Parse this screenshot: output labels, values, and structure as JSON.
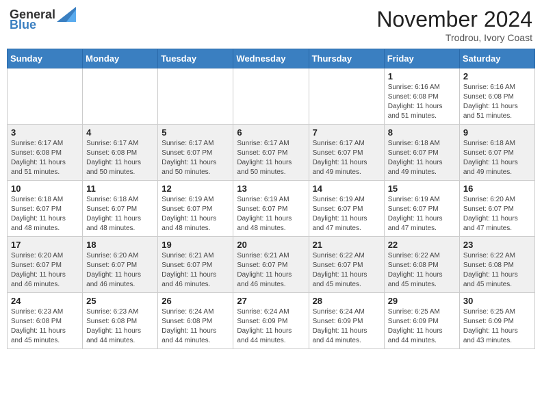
{
  "logo": {
    "text_general": "General",
    "text_blue": "Blue"
  },
  "title": "November 2024",
  "location": "Trodrou, Ivory Coast",
  "days_of_week": [
    "Sunday",
    "Monday",
    "Tuesday",
    "Wednesday",
    "Thursday",
    "Friday",
    "Saturday"
  ],
  "weeks": [
    [
      {
        "day": "",
        "info": ""
      },
      {
        "day": "",
        "info": ""
      },
      {
        "day": "",
        "info": ""
      },
      {
        "day": "",
        "info": ""
      },
      {
        "day": "",
        "info": ""
      },
      {
        "day": "1",
        "info": "Sunrise: 6:16 AM\nSunset: 6:08 PM\nDaylight: 11 hours and 51 minutes."
      },
      {
        "day": "2",
        "info": "Sunrise: 6:16 AM\nSunset: 6:08 PM\nDaylight: 11 hours and 51 minutes."
      }
    ],
    [
      {
        "day": "3",
        "info": "Sunrise: 6:17 AM\nSunset: 6:08 PM\nDaylight: 11 hours and 51 minutes."
      },
      {
        "day": "4",
        "info": "Sunrise: 6:17 AM\nSunset: 6:08 PM\nDaylight: 11 hours and 50 minutes."
      },
      {
        "day": "5",
        "info": "Sunrise: 6:17 AM\nSunset: 6:07 PM\nDaylight: 11 hours and 50 minutes."
      },
      {
        "day": "6",
        "info": "Sunrise: 6:17 AM\nSunset: 6:07 PM\nDaylight: 11 hours and 50 minutes."
      },
      {
        "day": "7",
        "info": "Sunrise: 6:17 AM\nSunset: 6:07 PM\nDaylight: 11 hours and 49 minutes."
      },
      {
        "day": "8",
        "info": "Sunrise: 6:18 AM\nSunset: 6:07 PM\nDaylight: 11 hours and 49 minutes."
      },
      {
        "day": "9",
        "info": "Sunrise: 6:18 AM\nSunset: 6:07 PM\nDaylight: 11 hours and 49 minutes."
      }
    ],
    [
      {
        "day": "10",
        "info": "Sunrise: 6:18 AM\nSunset: 6:07 PM\nDaylight: 11 hours and 48 minutes."
      },
      {
        "day": "11",
        "info": "Sunrise: 6:18 AM\nSunset: 6:07 PM\nDaylight: 11 hours and 48 minutes."
      },
      {
        "day": "12",
        "info": "Sunrise: 6:19 AM\nSunset: 6:07 PM\nDaylight: 11 hours and 48 minutes."
      },
      {
        "day": "13",
        "info": "Sunrise: 6:19 AM\nSunset: 6:07 PM\nDaylight: 11 hours and 48 minutes."
      },
      {
        "day": "14",
        "info": "Sunrise: 6:19 AM\nSunset: 6:07 PM\nDaylight: 11 hours and 47 minutes."
      },
      {
        "day": "15",
        "info": "Sunrise: 6:19 AM\nSunset: 6:07 PM\nDaylight: 11 hours and 47 minutes."
      },
      {
        "day": "16",
        "info": "Sunrise: 6:20 AM\nSunset: 6:07 PM\nDaylight: 11 hours and 47 minutes."
      }
    ],
    [
      {
        "day": "17",
        "info": "Sunrise: 6:20 AM\nSunset: 6:07 PM\nDaylight: 11 hours and 46 minutes."
      },
      {
        "day": "18",
        "info": "Sunrise: 6:20 AM\nSunset: 6:07 PM\nDaylight: 11 hours and 46 minutes."
      },
      {
        "day": "19",
        "info": "Sunrise: 6:21 AM\nSunset: 6:07 PM\nDaylight: 11 hours and 46 minutes."
      },
      {
        "day": "20",
        "info": "Sunrise: 6:21 AM\nSunset: 6:07 PM\nDaylight: 11 hours and 46 minutes."
      },
      {
        "day": "21",
        "info": "Sunrise: 6:22 AM\nSunset: 6:07 PM\nDaylight: 11 hours and 45 minutes."
      },
      {
        "day": "22",
        "info": "Sunrise: 6:22 AM\nSunset: 6:08 PM\nDaylight: 11 hours and 45 minutes."
      },
      {
        "day": "23",
        "info": "Sunrise: 6:22 AM\nSunset: 6:08 PM\nDaylight: 11 hours and 45 minutes."
      }
    ],
    [
      {
        "day": "24",
        "info": "Sunrise: 6:23 AM\nSunset: 6:08 PM\nDaylight: 11 hours and 45 minutes."
      },
      {
        "day": "25",
        "info": "Sunrise: 6:23 AM\nSunset: 6:08 PM\nDaylight: 11 hours and 44 minutes."
      },
      {
        "day": "26",
        "info": "Sunrise: 6:24 AM\nSunset: 6:08 PM\nDaylight: 11 hours and 44 minutes."
      },
      {
        "day": "27",
        "info": "Sunrise: 6:24 AM\nSunset: 6:09 PM\nDaylight: 11 hours and 44 minutes."
      },
      {
        "day": "28",
        "info": "Sunrise: 6:24 AM\nSunset: 6:09 PM\nDaylight: 11 hours and 44 minutes."
      },
      {
        "day": "29",
        "info": "Sunrise: 6:25 AM\nSunset: 6:09 PM\nDaylight: 11 hours and 44 minutes."
      },
      {
        "day": "30",
        "info": "Sunrise: 6:25 AM\nSunset: 6:09 PM\nDaylight: 11 hours and 43 minutes."
      }
    ]
  ]
}
